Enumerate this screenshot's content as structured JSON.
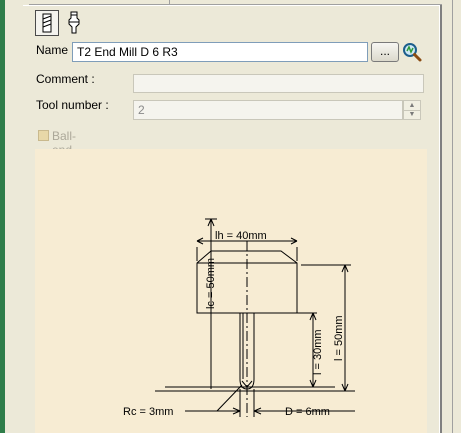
{
  "form": {
    "name_label": "Name",
    "name_value": "T2 End Mill D 6 R3",
    "browse_label": "...",
    "comment_label": "Comment :",
    "comment_value": "",
    "tool_number_label": "Tool number :",
    "tool_number_value": "2",
    "ball_end_label": "Ball-end tool",
    "ball_end_checked": false
  },
  "tool_icons": [
    "end-mill-icon",
    "tool-holder-icon"
  ],
  "drawing": {
    "lh_label": "lh = 40mm",
    "lc_label": "lc = 50mm",
    "l_label": "l = 50mm",
    "length3_label": "l = 30mm",
    "rc_label": "Rc = 3mm",
    "d_label": "D = 6mm"
  },
  "colors": {
    "panel": "#ece9d8",
    "drawing_background": "#f7ecd3",
    "field_border": "#7f9db9"
  }
}
